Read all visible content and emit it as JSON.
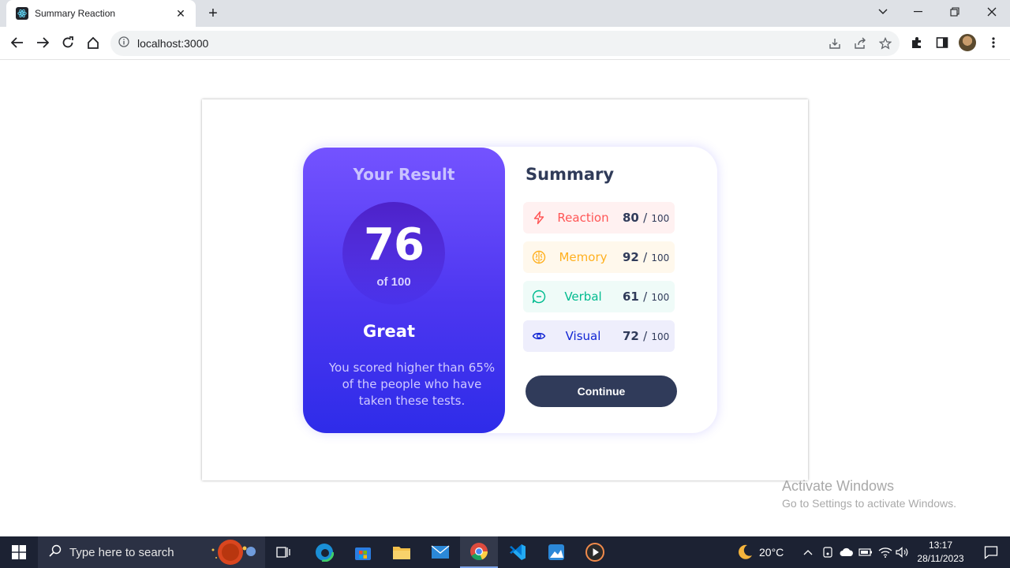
{
  "browser": {
    "tab_title": "Summary Reaction",
    "tab_close": "✕",
    "new_tab": "+",
    "url": "localhost:3000"
  },
  "result": {
    "title": "Your Result",
    "score": "76",
    "of_label": "of 100",
    "grade": "Great",
    "description": "You scored higher than 65% of the people who have taken these tests."
  },
  "summary": {
    "title": "Summary",
    "items": [
      {
        "label": "Reaction",
        "score": "80",
        "sep": "/",
        "max": "100",
        "color": "#f55",
        "bg": "#fff1f1",
        "icon": "lightning-icon"
      },
      {
        "label": "Memory",
        "score": "92",
        "sep": "/",
        "max": "100",
        "color": "#ffb01f",
        "bg": "#fff8ec",
        "icon": "brain-icon"
      },
      {
        "label": "Verbal",
        "score": "61",
        "sep": "/",
        "max": "100",
        "color": "#00bb8f",
        "bg": "#effbf8",
        "icon": "chat-icon"
      },
      {
        "label": "Visual",
        "score": "72",
        "sep": "/",
        "max": "100",
        "color": "#1125d4",
        "bg": "#eeeefc",
        "icon": "eye-icon"
      }
    ],
    "continue_label": "Continue"
  },
  "watermark": {
    "line1": "Activate Windows",
    "line2": "Go to Settings to activate Windows."
  },
  "taskbar": {
    "search_placeholder": "Type here to search",
    "weather": "20°C",
    "time": "13:17",
    "date": "28/11/2023"
  }
}
